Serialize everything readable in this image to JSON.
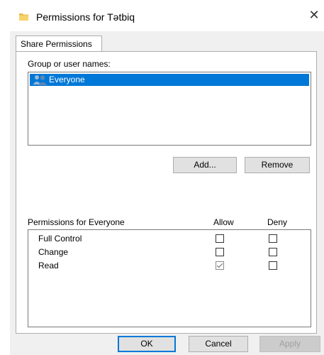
{
  "window": {
    "title": "Permissions for Tətbiq",
    "close_symbol": "✕"
  },
  "tabs": [
    {
      "label": "Share Permissions",
      "active": true
    }
  ],
  "group_section": {
    "label": "Group or user names:",
    "items": [
      {
        "name": "Everyone",
        "icon": "users-icon",
        "selected": true
      }
    ]
  },
  "buttons": {
    "add": "Add...",
    "remove": "Remove",
    "ok": "OK",
    "cancel": "Cancel",
    "apply": "Apply"
  },
  "permissions": {
    "label": "Permissions for Everyone",
    "allow_header": "Allow",
    "deny_header": "Deny",
    "rows": [
      {
        "name": "Full Control",
        "allow": false,
        "deny": false
      },
      {
        "name": "Change",
        "allow": false,
        "deny": false
      },
      {
        "name": "Read",
        "allow": true,
        "deny": false
      }
    ]
  },
  "colors": {
    "selection": "#0078d7",
    "dialog_bg": "#f0f0f0"
  }
}
